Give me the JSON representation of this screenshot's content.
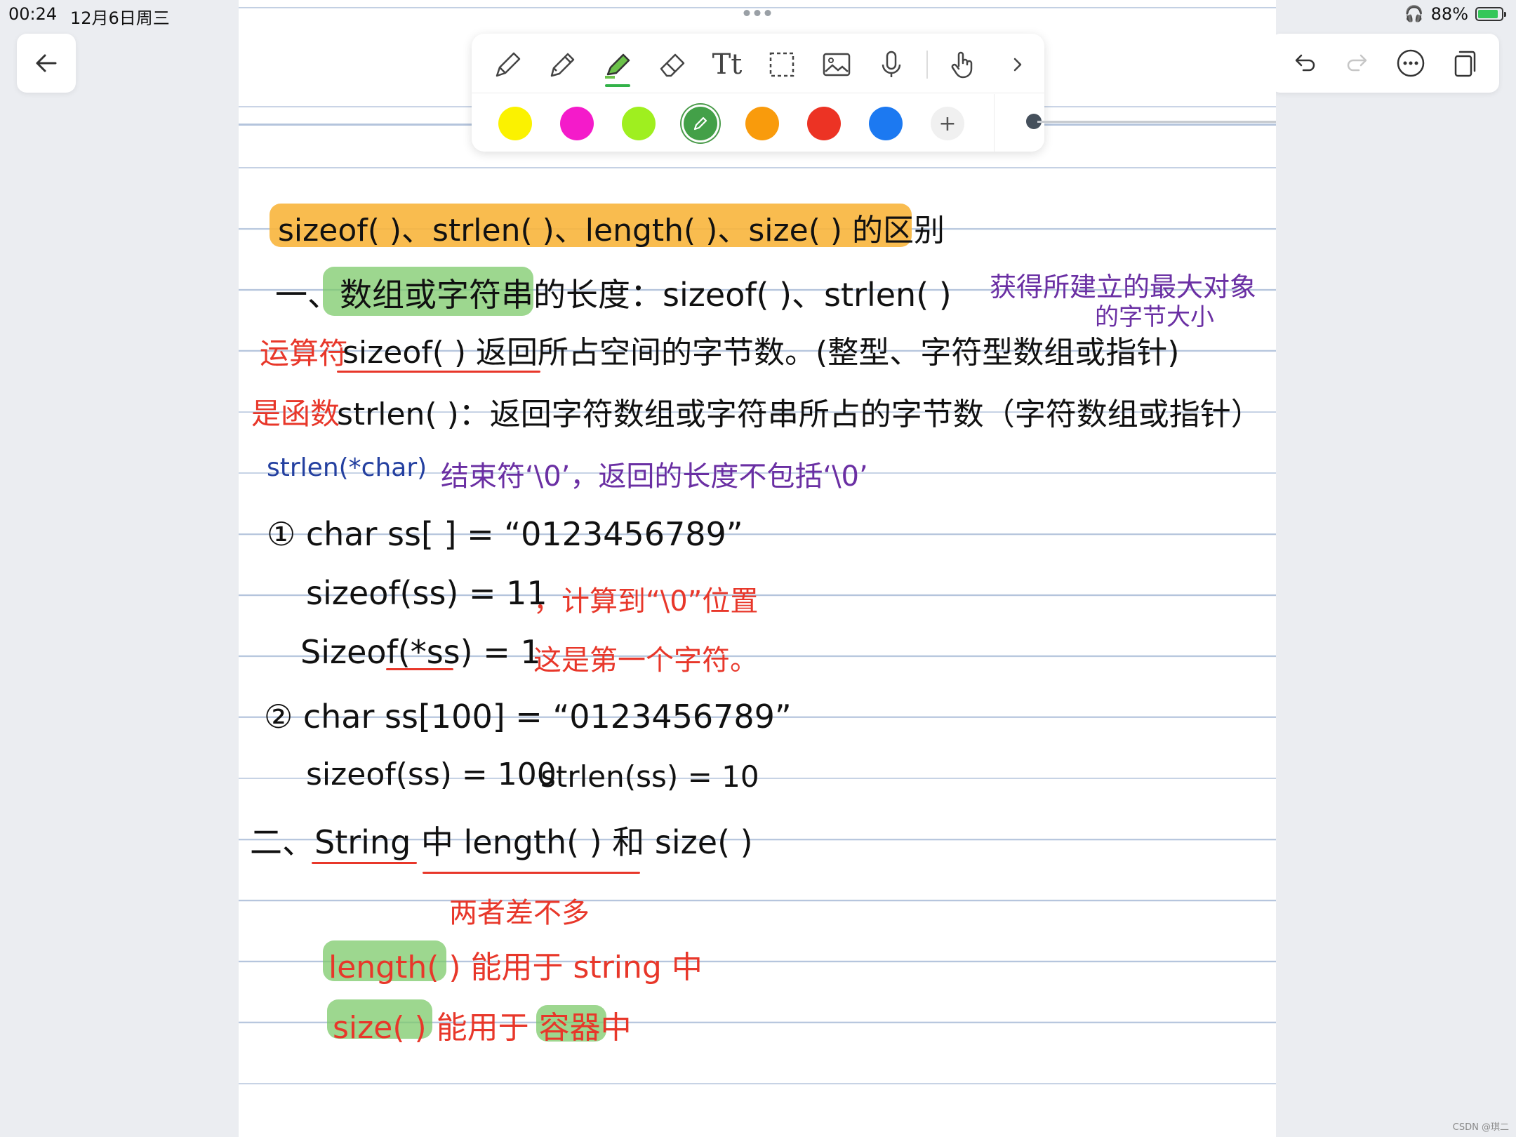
{
  "status_bar": {
    "time": "00:24",
    "date": "12月6日周三",
    "battery_percent": "88%",
    "battery_level": 0.88
  },
  "toolbar": {
    "tools": [
      "pen-icon",
      "pencil-icon",
      "highlighter-icon",
      "eraser-icon",
      "text-icon",
      "lasso-select-icon",
      "image-icon",
      "microphone-icon",
      "touch-icon",
      "chevron-right-icon"
    ],
    "active_tool": "highlighter-icon",
    "text_tool_label": "Tt",
    "colors": [
      "#fbf200",
      "#f41bca",
      "#9fef1f",
      "#43a048",
      "#f99b0c",
      "#ec3324",
      "#1c79f1"
    ],
    "selected_color": "#43a048",
    "add_label": "+"
  },
  "right_menu": {
    "icons": [
      "undo-icon",
      "redo-icon",
      "more-icon",
      "pages-icon"
    ]
  },
  "note": {
    "title": "sizeof( )、strlen( )、length( )、size( ) 的区别",
    "section1_heading": "一、数组或字符串的长度：sizeof( )、strlen( )",
    "note_purple_1": "获得所建立的最大对象",
    "note_purple_2": "的字节大小",
    "operator_label": "运算符",
    "sizeof_desc": "sizeof( ) 返回所占空间的字节数。(整型、字符型数组或指针)",
    "function_label": "是函数",
    "strlen_desc": "strlen( )：返回字符数组或字符串所占的字节数（字符数组或指针）",
    "strlen_sig": "strlen(*char)",
    "strlen_note": "结束符‘\\0’，返回的长度不包括‘\\0’",
    "ex1_code": "① char ss[ ] = “0123456789”",
    "ex1_sizeof": "sizeof(ss) = 11",
    "ex1_note": "，计算到“\\0”位置",
    "ex1_sizeof_ptr": "Sizeof(*ss) = 1",
    "ex1_ptr_note": "这是第一个字符。",
    "ex2_code": "② char ss[100] = “0123456789”",
    "ex2_sizeof": "sizeof(ss) = 100",
    "ex2_strlen": "strlen(ss) = 10",
    "section2_heading": "二、String 中 length( ) 和 size( )",
    "section2_note": "两者差不多",
    "length_desc": "length( ) 能用于 string 中",
    "size_desc": "size( ) 能用于 容器中"
  },
  "watermark": "CSDN @琪二"
}
